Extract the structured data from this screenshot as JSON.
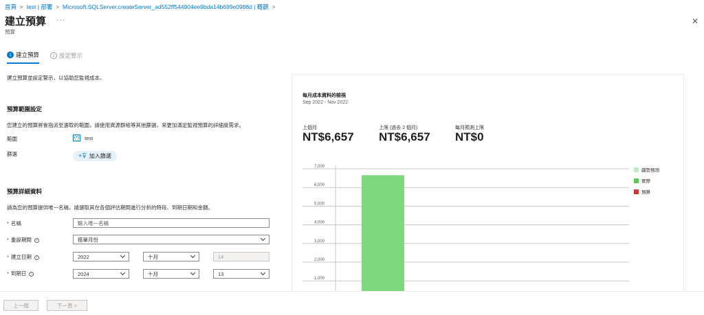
{
  "breadcrumb": {
    "items": [
      "首頁",
      "test | 部署",
      "Microsoft.SQLServer.createServer_ad552ff544904ee9bda14b699e0988d | 概觀"
    ]
  },
  "header": {
    "title": "建立預算",
    "subtitle": "預算",
    "more": "···"
  },
  "steps": [
    {
      "num": "1",
      "label": "建立預算"
    },
    {
      "num": "2",
      "label": "設定警示"
    }
  ],
  "intro": "建立預算並設定警示，以協助您監視成本。",
  "scope": {
    "heading": "預算範圍設定",
    "description": "您建立的預算將會指派至選取的範圍，請使用資源群組等其他篩選，來更加滿足監視預算的詳細度需求。",
    "scope_label": "範圍",
    "scope_value": "test",
    "filter_label": "篩選",
    "add_filter": "加入篩選"
  },
  "details": {
    "heading": "預算詳細資料",
    "description": "請為您的預算提供唯一名稱，請選取其在各個評估期間進行分析的時段、到期日期和金額。",
    "name_label": "名稱",
    "name_placeholder": "輸入唯一名稱",
    "reset_label": "重設期間",
    "reset_value": "搭單月份",
    "create_label": "建立日期",
    "create_year": "2022",
    "create_month": "十月",
    "create_day": "14",
    "expire_label": "到期日",
    "expire_year": "2024",
    "expire_month": "十月",
    "expire_day": "13"
  },
  "panel": {
    "title": "每月成本資料的檢視",
    "range": "Sep 2022 - Nov 2022",
    "stats": [
      {
        "label": "上個月",
        "value": "NT$6,657"
      },
      {
        "label": "上限 (過去 2 個月)",
        "value": "NT$6,657"
      },
      {
        "label": "每月預測上限",
        "value": "NT$0"
      }
    ]
  },
  "chart_data": {
    "type": "bar",
    "categories": [
      ""
    ],
    "series": [
      {
        "name": "實際",
        "values": [
          6657
        ],
        "color": "#7ed97e"
      }
    ],
    "legend": [
      {
        "name": "趨勢預測",
        "color": "#c3ebc3"
      },
      {
        "name": "實際",
        "color": "#5ac85a"
      },
      {
        "name": "預算",
        "color": "#d13438"
      }
    ],
    "yticks": [
      "7,000",
      "6,000",
      "5,000",
      "4,000",
      "3,000",
      "2,000",
      "1,000"
    ],
    "ylim": [
      0,
      7000
    ]
  },
  "footer": {
    "prev": "上一個",
    "next": "下一頁 >"
  }
}
